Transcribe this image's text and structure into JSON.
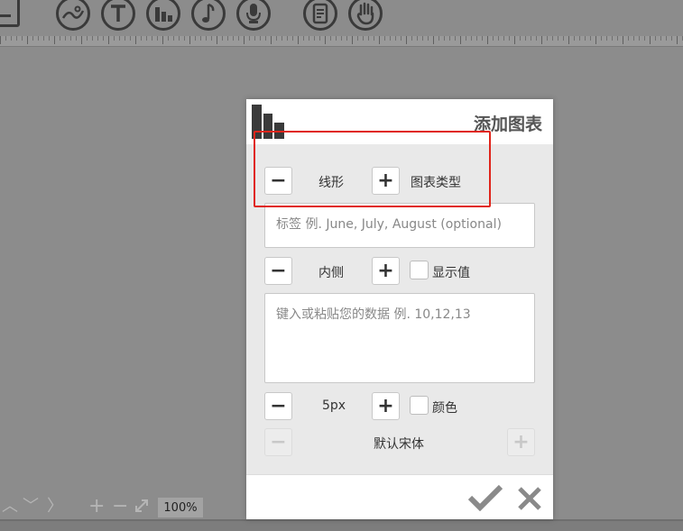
{
  "toolbar": {
    "icons": [
      "frame-icon",
      "image-icon",
      "text-icon",
      "chart-icon",
      "music-icon",
      "microphone-icon",
      "note-icon",
      "hand-icon"
    ]
  },
  "bottom": {
    "zoom": "100%"
  },
  "dialog": {
    "title": "添加图表",
    "chart_type": {
      "value": "线形",
      "label": "图表类型"
    },
    "labels_field": {
      "placeholder": "标签 例. June, July, August (optional)"
    },
    "position": {
      "value": "内侧",
      "show_values_label": "显示值",
      "show_values_checked": false
    },
    "data_field": {
      "placeholder": "键入或粘贴您的数据 例. 10,12,13"
    },
    "line_width": {
      "value": "5px",
      "color_label": "颜色",
      "color_checked": false
    },
    "font": {
      "value": "默认宋体"
    }
  },
  "colors": {
    "highlight": "#e0241a",
    "background": "#8c8c8c"
  }
}
